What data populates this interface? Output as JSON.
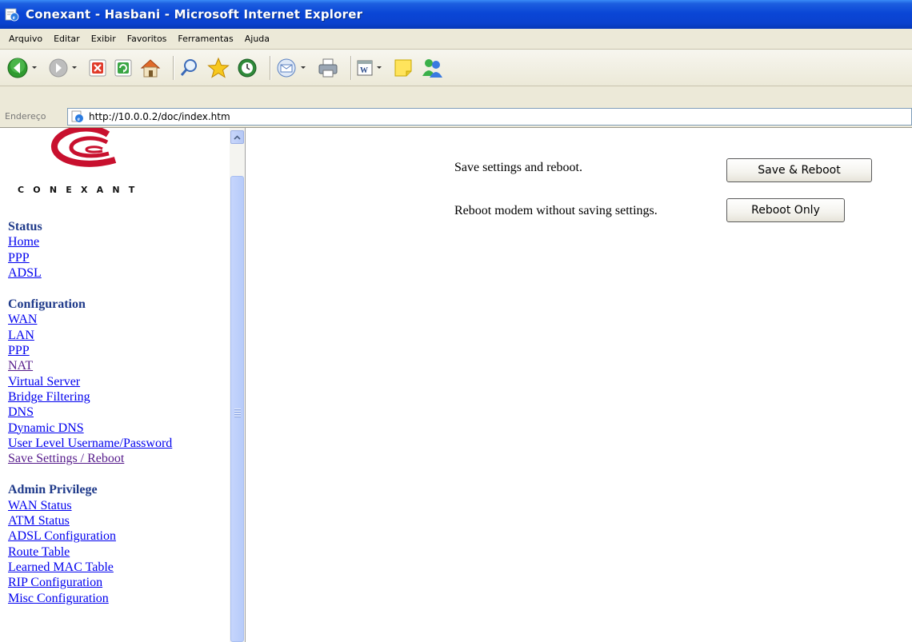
{
  "window": {
    "title": "Conexant - Hasbani - Microsoft Internet Explorer"
  },
  "menu": {
    "items": [
      "Arquivo",
      "Editar",
      "Exibir",
      "Favoritos",
      "Ferramentas",
      "Ajuda"
    ]
  },
  "toolbar": {
    "buttons": [
      "back-icon",
      "forward-icon",
      "stop-icon",
      "refresh-icon",
      "home-icon",
      "search-icon",
      "favorites-icon",
      "history-icon",
      "mail-icon",
      "print-icon",
      "edit-icon",
      "notes-icon",
      "messenger-icon"
    ]
  },
  "address": {
    "label": "Endereço",
    "url": "http://10.0.0.2/doc/index.htm"
  },
  "sidebar": {
    "logo_text": "CONEXANT",
    "sections": [
      {
        "heading": "Status",
        "links": [
          "Home",
          "PPP",
          "ADSL"
        ]
      },
      {
        "heading": "Configuration",
        "links": [
          "WAN",
          "LAN",
          "PPP",
          "NAT",
          "Virtual Server",
          "Bridge Filtering",
          "DNS",
          "Dynamic DNS",
          "User Level Username/Password",
          "Save Settings / Reboot"
        ]
      },
      {
        "heading": "Admin Privilege",
        "links": [
          "WAN Status",
          "ATM Status",
          "ADSL Configuration",
          "Route Table",
          "Learned MAC Table",
          "RIP Configuration",
          "Misc Configuration"
        ]
      }
    ],
    "visited_links": [
      "NAT",
      "Save Settings / Reboot"
    ]
  },
  "main": {
    "save_reboot_label": "Save settings and reboot.",
    "save_reboot_button": "Save & Reboot",
    "reboot_only_label": "Reboot modem without saving settings.",
    "reboot_only_button": "Reboot Only"
  },
  "colors": {
    "titlebar": "#0a46d6",
    "chrome": "#ece9d8",
    "link": "#0000ee",
    "visited_link": "#551a8b",
    "heading": "#1f3a8a",
    "logo_red": "#c8102e"
  }
}
